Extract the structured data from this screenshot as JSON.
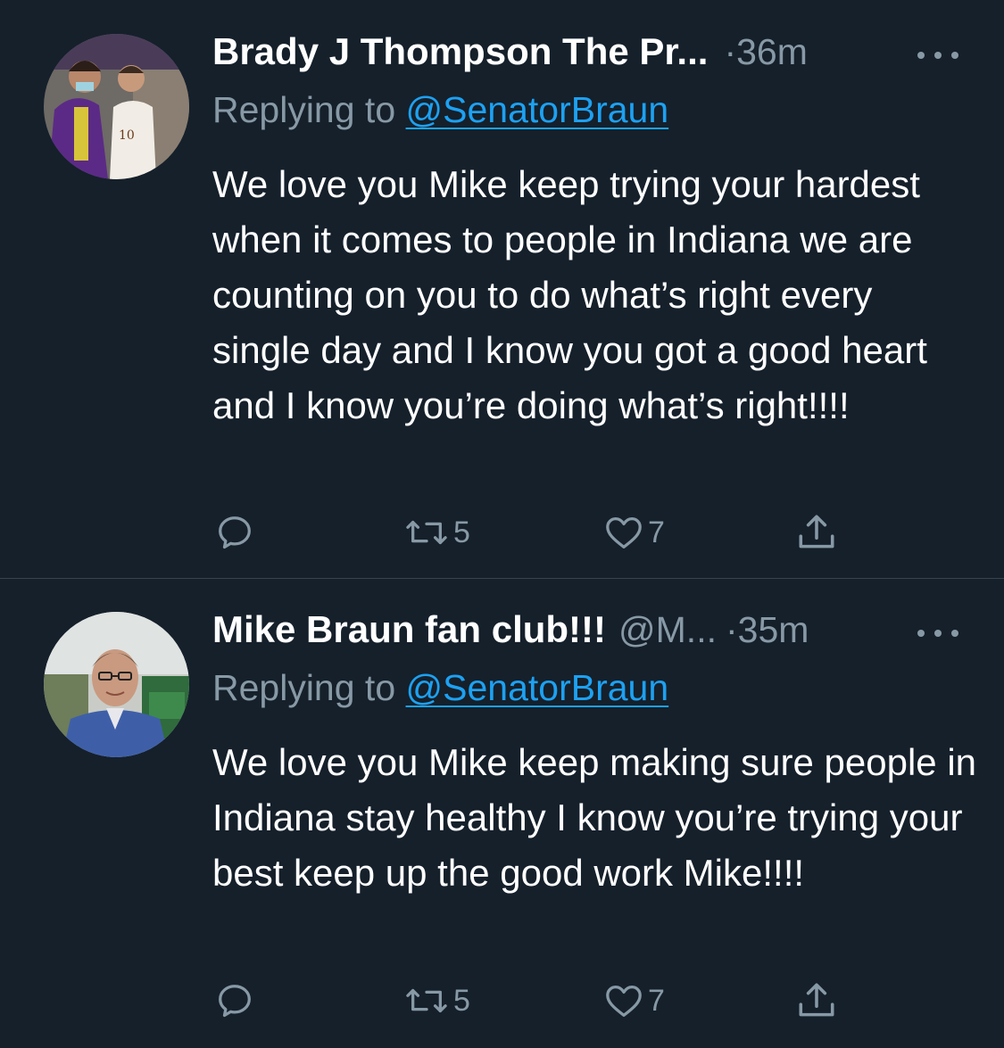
{
  "colors": {
    "background": "#15202b",
    "text": "#ffffff",
    "secondary": "#8899a6",
    "link": "#1da1f2",
    "divider": "#38444d"
  },
  "tweets": [
    {
      "name": "Brady J Thompson The Pr...",
      "handle": "",
      "separator": "·",
      "time": "36m",
      "replying_prefix": "Replying to",
      "replying_to": "@SenatorBraun",
      "text": "We love you Mike keep trying your hardest when it comes to people in Indiana we are counting on you to do what’s right every single day and I know you got a good heart and I know you’re doing what’s right!!!!",
      "retweets": "5",
      "likes": "7",
      "icons": [
        "reply-icon",
        "retweet-icon",
        "like-icon",
        "share-icon"
      ]
    },
    {
      "name": "Mike Braun fan club!!!",
      "handle": "@M...",
      "separator": "·",
      "time": "35m",
      "replying_prefix": "Replying to",
      "replying_to": "@SenatorBraun",
      "text": "We love you Mike keep making sure people in Indiana stay healthy I know you’re trying your best keep up the good work Mike!!!!",
      "retweets": "5",
      "likes": "7",
      "icons": [
        "reply-icon",
        "retweet-icon",
        "like-icon",
        "share-icon"
      ]
    }
  ]
}
